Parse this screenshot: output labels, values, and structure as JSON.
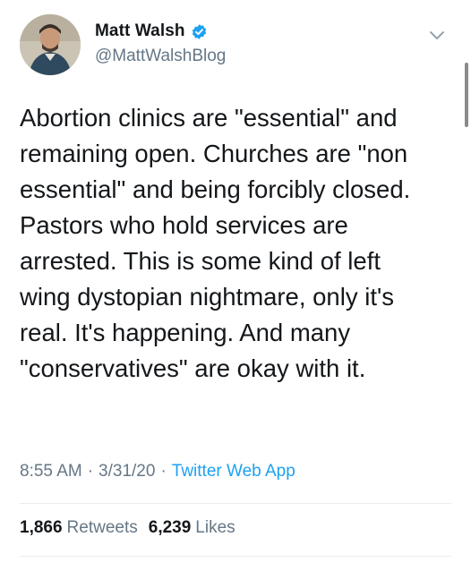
{
  "header": {
    "display_name": "Matt Walsh",
    "handle": "@MattWalshBlog",
    "icons": {
      "verified": "verified-badge-icon",
      "menu": "chevron-down-icon"
    },
    "colors": {
      "verified": "#1da1f2"
    }
  },
  "tweet": {
    "text": "Abortion clinics are \"essential\" and\nremaining open. Churches are \"non\nessential\" and being forcibly closed.\nPastors who hold services are\narrested. This is some kind of left\nwing dystopian nightmare, only it's\nreal. It's happening. And many\n\"conservatives\" are okay with it."
  },
  "meta": {
    "time": "8:55 AM",
    "separator": "·",
    "date": "3/31/20",
    "source": "Twitter Web App"
  },
  "stats": {
    "retweets_count": "1,866",
    "retweets_label": "Retweets",
    "likes_count": "6,239",
    "likes_label": "Likes"
  },
  "colors": {
    "link": "#1da1f2",
    "secondary_text": "#657786",
    "primary_text": "#14171a",
    "divider": "#e6ecf0"
  }
}
